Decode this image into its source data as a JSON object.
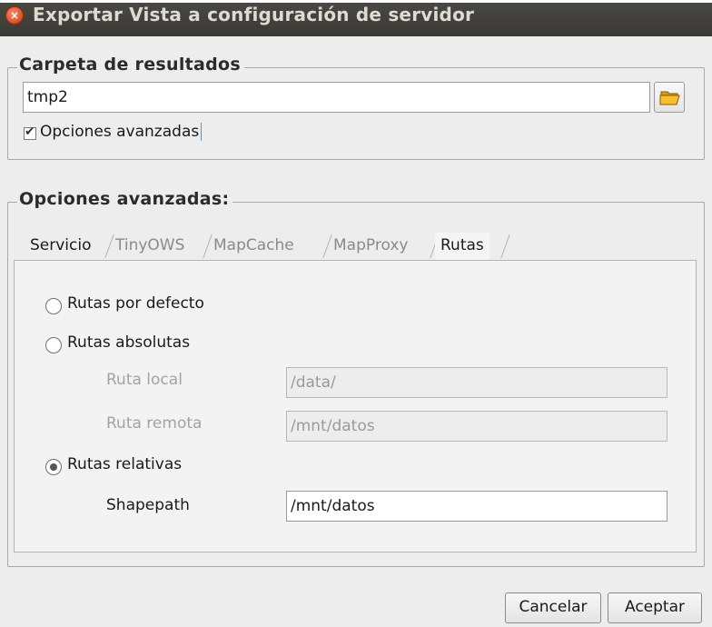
{
  "window": {
    "title": "Exportar Vista a configuración de servidor",
    "close_glyph": "×"
  },
  "results_group": {
    "legend": "Carpeta de resultados",
    "folder_value": "tmp2",
    "advanced_checkbox": {
      "label": "Opciones avanzadas",
      "checked": true
    }
  },
  "advanced_group": {
    "legend": "Opciones avanzadas:",
    "tabs": [
      {
        "label": "Servicio",
        "state": "normal"
      },
      {
        "label": "TinyOWS",
        "state": "inactive"
      },
      {
        "label": "MapCache",
        "state": "inactive"
      },
      {
        "label": "MapProxy",
        "state": "inactive"
      },
      {
        "label": "Rutas",
        "state": "selected"
      }
    ],
    "rutas": {
      "default_radio": {
        "label": "Rutas por defecto",
        "selected": false
      },
      "absolute_radio": {
        "label": "Rutas absolutas",
        "selected": false
      },
      "local_path": {
        "label": "Ruta local",
        "value": "/data/",
        "enabled": false
      },
      "remote_path": {
        "label": "Ruta remota",
        "value": "/mnt/datos",
        "enabled": false
      },
      "relative_radio": {
        "label": "Rutas relativas",
        "selected": true
      },
      "shapepath": {
        "label": "Shapepath",
        "value": "/mnt/datos",
        "enabled": true
      }
    }
  },
  "buttons": {
    "cancel_label": "Cancelar",
    "accept_label": "Aceptar"
  },
  "icons": {
    "close": "close-icon",
    "folder": "folder-icon"
  },
  "colors": {
    "titlebar": "#3c3b37",
    "close_button": "#e0572e",
    "folder_icon": "#f2b51d"
  }
}
